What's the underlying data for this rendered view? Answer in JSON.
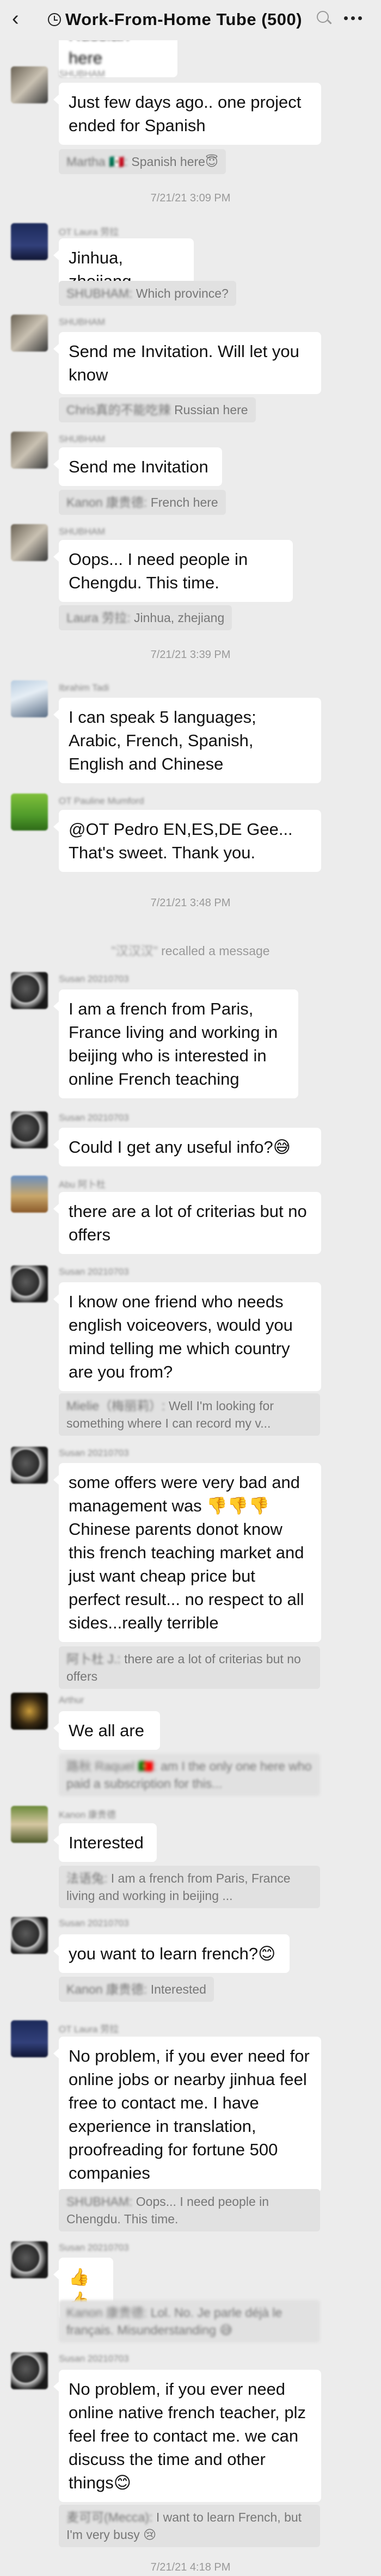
{
  "header": {
    "back_icon": "chevron-left-icon",
    "title": "Work-From-Home Tube (500)",
    "title_icon": "clock-icon",
    "search_icon": "search-icon",
    "more_icon": "more-dots-icon"
  },
  "messages": {
    "m0": {
      "text": "Russian here"
    },
    "m1": {
      "sender": "SHUBHAM",
      "text": "Just few days ago.. one project ended for Spanish",
      "quote_name": "Martha 🇲🇽:",
      "quote_text": "Spanish here😇"
    },
    "t1": {
      "text": "7/21/21 3:09 PM"
    },
    "m2": {
      "sender": "OT Laura 劳拉",
      "text": "Jinhua, zhejiang",
      "quote_name": "SHUBHAM:",
      "quote_text": "Which province?"
    },
    "m3": {
      "sender": "SHUBHAM",
      "text": "Send me Invitation. Will let you know",
      "quote_name": "Chris真的不能吃辣",
      "quote_text": "Russian here"
    },
    "m4": {
      "sender": "SHUBHAM",
      "text": "Send me Invitation",
      "quote_name": "Kanon 康贵德:",
      "quote_text": "French here"
    },
    "m5": {
      "sender": "SHUBHAM",
      "text": "Oops... I need people in Chengdu. This time.",
      "quote_name": "Laura 劳拉:",
      "quote_text": "Jinhua, zhejiang"
    },
    "t2": {
      "text": "7/21/21 3:39 PM"
    },
    "m6": {
      "sender": "Ibrahim Tadi",
      "text": "I can speak 5 languages; Arabic, French, Spanish, English and Chinese"
    },
    "m7": {
      "sender": "OT Pauline Mumford",
      "text_mention": "@OT Pedro EN,ES,DE",
      "text": " Gee... That's sweet. Thank you."
    },
    "t3": {
      "text": "7/21/21 3:48 PM"
    },
    "sys1": {
      "name": "\"汉汉汉\"",
      "text": " recalled a message"
    },
    "m8": {
      "sender": "Susan 20210703",
      "text": "I am a french from Paris, France living and working in beijing who is interested in online French teaching"
    },
    "m9": {
      "sender": "Susan 20210703",
      "text": "Could I get any useful info?😅"
    },
    "m10": {
      "sender": "Abu 阿卜杜",
      "text": "there are a lot of criterias but no offers"
    },
    "m11": {
      "sender": "Susan 20210703",
      "text": "I know one friend who needs english voiceovers, would you mind telling me which country are you from?",
      "quote_name": "Mielie（梅丽莉）:",
      "quote_text": "Well I'm looking for something where I can record my v..."
    },
    "m12": {
      "sender": "Susan 20210703",
      "text": "some offers were very bad and management was 👎👎👎 Chinese parents donot know this french teaching market and just want cheap price but perfect result... no respect to all sides...really terrible",
      "quote_name": "阿卜杜 J.:",
      "quote_text": "there are a lot of criterias but no offers"
    },
    "m13": {
      "sender": "Arthur",
      "text": "We all are",
      "quote_name": "路秋 Raquel 🇵🇹:",
      "quote_text": "am I the only one here who paid a subscription for this..."
    },
    "m14": {
      "sender": "Kanon 康贵德",
      "text": "Interested",
      "quote_name": "法语兔:",
      "quote_text": "I am a french from Paris, France living and working in beijing ..."
    },
    "m15": {
      "sender": "Susan 20210703",
      "text": "you want to learn french?😊",
      "quote_name": "Kanon 康贵德:",
      "quote_text": "Interested"
    },
    "m16": {
      "sender": "OT Laura 劳拉",
      "text": "No problem, if you ever need for online jobs or nearby jinhua feel free to contact me. I have experience in translation, proofreading for fortune 500 companies",
      "quote_name": "SHUBHAM:",
      "quote_text": "Oops... I need people in Chengdu. This time."
    },
    "m17": {
      "sender": "Susan 20210703",
      "text": "👍👍",
      "quote_name": "Kanon 康贵德:",
      "quote_text": "Lol. No. Je parle déjà le français. Misunderstanding 😅"
    },
    "m18": {
      "sender": "Susan 20210703",
      "text": "No problem, if you ever need online native french teacher, plz feel free to contact me. we can discuss the time and other things😊",
      "quote_name": "麦可可(Mecca):",
      "quote_text": "I want to learn French, but I'm very busy 😢"
    },
    "t4": {
      "text": "7/21/21 4:18 PM"
    }
  },
  "colors": {
    "background": "#ececec",
    "bubble": "#ffffff",
    "quote": "#e1e1e1",
    "timestamp": "#999999"
  }
}
